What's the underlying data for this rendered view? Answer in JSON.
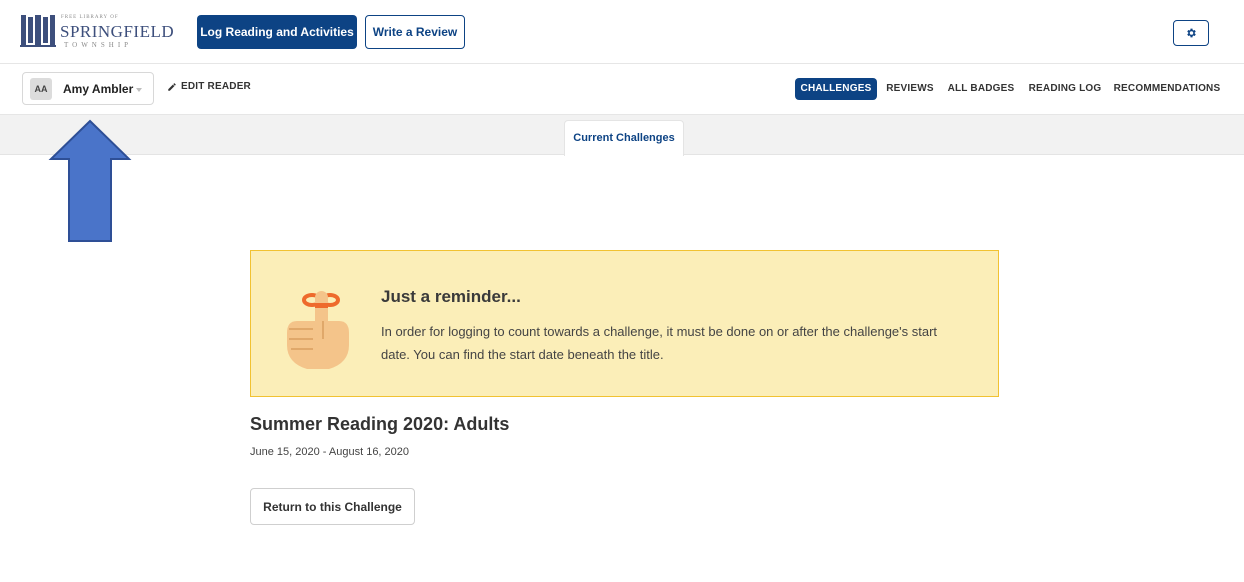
{
  "header": {
    "logo": {
      "small_text": "FREE LIBRARY OF",
      "name": "SPRINGFIELD",
      "sub_text": "TOWNSHIP"
    },
    "log_button_label": "Log Reading and Activities",
    "review_button_label": "Write a Review",
    "settings_icon": "gear-icon"
  },
  "reader": {
    "initials": "AA",
    "name": "Amy Ambler",
    "edit_label": "EDIT READER",
    "edit_icon": "pencil-icon"
  },
  "nav": {
    "tabs": [
      {
        "label": "CHALLENGES",
        "active": true
      },
      {
        "label": "REVIEWS",
        "active": false
      },
      {
        "label": "ALL BADGES",
        "active": false
      },
      {
        "label": "READING LOG",
        "active": false
      },
      {
        "label": "RECOMMENDATIONS",
        "active": false
      }
    ]
  },
  "subtabs": {
    "current": "Current Challenges"
  },
  "reminder": {
    "title": "Just a reminder...",
    "body": "In order for logging to count towards a challenge, it must be done on or after the challenge's start date. You can find the start date beneath the title.",
    "icon": "finger-ribbon-reminder-icon"
  },
  "challenge": {
    "title": "Summer Reading 2020: Adults",
    "dates": "June 15, 2020 - August 16, 2020",
    "return_button_label": "Return to this Challenge"
  },
  "colors": {
    "primary": "#0d4384",
    "reminder_bg": "#fbeeb8",
    "reminder_border": "#f1c232",
    "annotation_arrow": "#4a74c9"
  }
}
